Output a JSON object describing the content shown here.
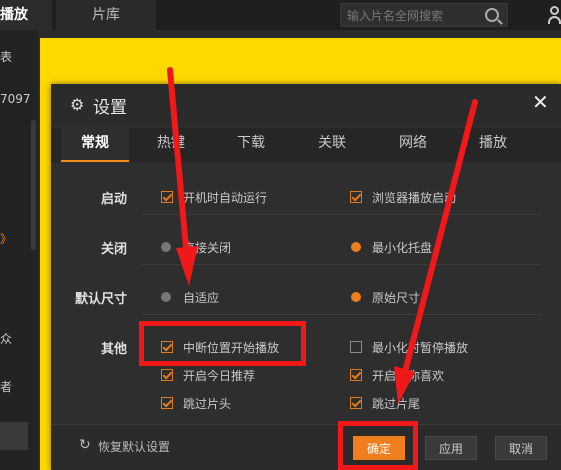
{
  "topbar": {
    "tab_play": "播放",
    "tab_library": "片库",
    "search_placeholder": "输入片名全网搜索",
    "icons": [
      "search-icon",
      "user-icon"
    ]
  },
  "sidebar": {
    "items": [
      "表",
      "7097",
      "》",
      "众",
      "者"
    ]
  },
  "dialog": {
    "title": "设置",
    "tabs": [
      "常规",
      "热键",
      "下载",
      "关联",
      "网络",
      "播放"
    ],
    "active_tab": "常规",
    "rows": [
      {
        "label": "启动",
        "options": [
          {
            "text": "开机时自动运行",
            "type": "checkbox",
            "checked": true
          },
          {
            "text": "浏览器播放启动",
            "type": "checkbox",
            "checked": true
          }
        ]
      },
      {
        "label": "关闭",
        "options": [
          {
            "text": "直接关闭",
            "type": "radio",
            "checked": false
          },
          {
            "text": "最小化托盘",
            "type": "radio",
            "checked": true
          }
        ]
      },
      {
        "label": "默认尺寸",
        "options": [
          {
            "text": "自适应",
            "type": "radio",
            "checked": false
          },
          {
            "text": "原始尺寸",
            "type": "radio",
            "checked": true
          }
        ]
      },
      {
        "label": "其他",
        "options": [
          {
            "text": "中断位置开始播放",
            "type": "checkbox",
            "checked": true
          },
          {
            "text": "最小化时暂停播放",
            "type": "checkbox",
            "checked": false
          },
          {
            "text": "开启今日推荐",
            "type": "checkbox",
            "checked": true
          },
          {
            "text": "开启猜你喜欢",
            "type": "checkbox",
            "checked": true
          },
          {
            "text": "跳过片头",
            "type": "checkbox",
            "checked": true
          },
          {
            "text": "跳过片尾",
            "type": "checkbox",
            "checked": true
          }
        ]
      }
    ],
    "footer": {
      "restore_label": "恢复默认设置",
      "confirm_label": "确定",
      "apply_label": "应用",
      "cancel_label": "取消"
    }
  },
  "colors": {
    "accent": "#f07d1e",
    "annotation_red": "#f01818",
    "background_yellow": "#ffd800"
  }
}
